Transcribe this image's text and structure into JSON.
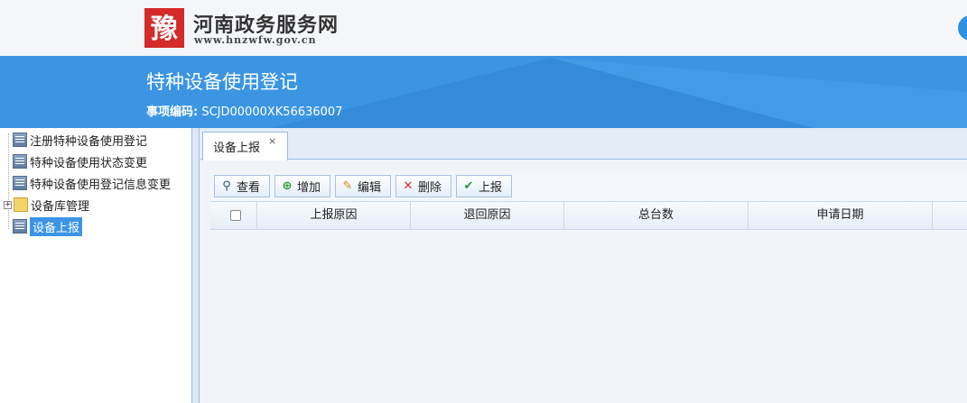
{
  "site": {
    "logo_glyph": "豫",
    "name": "河南政务服务网",
    "url": "www.hnzwfw.gov.cn"
  },
  "banner": {
    "title": "特种设备使用登记",
    "code_label": "事项编码:",
    "code_value": "SCJD00000XK56636007"
  },
  "tree": {
    "items": [
      {
        "label": "注册特种设备使用登记",
        "icon": "document-icon"
      },
      {
        "label": "特种设备使用状态变更",
        "icon": "document-icon"
      },
      {
        "label": "特种设备使用登记信息变更",
        "icon": "document-icon"
      },
      {
        "label": "设备库管理",
        "icon": "folder-icon",
        "expander": "+"
      },
      {
        "label": "设备上报",
        "icon": "document-icon",
        "selected": true
      }
    ]
  },
  "tab": {
    "label": "设备上报",
    "close": "×"
  },
  "toolbar": {
    "view": "查看",
    "add": "增加",
    "edit": "编辑",
    "delete": "删除",
    "report": "上报"
  },
  "grid": {
    "columns": [
      "上报原因",
      "退回原因",
      "总台数",
      "申请日期"
    ]
  },
  "colors": {
    "banner": "#3b95e3",
    "selected": "#3b95e3",
    "panel_border": "#99bbe8"
  }
}
